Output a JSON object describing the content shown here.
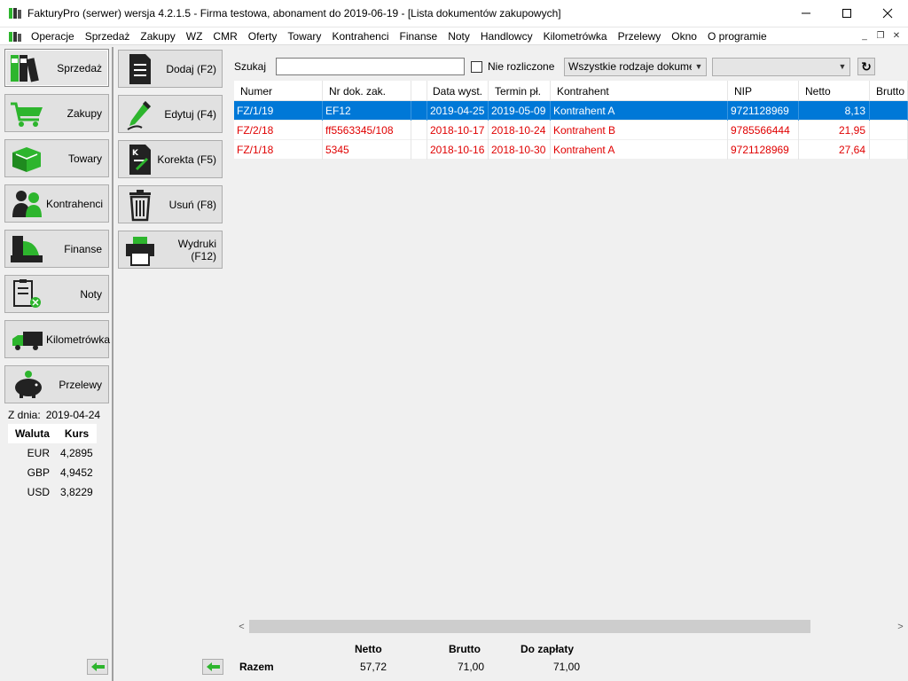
{
  "window": {
    "title": "FakturyPro (serwer) wersja 4.2.1.5 - Firma testowa, abonament do 2019-06-19 - [Lista dokumentów zakupowych]",
    "minimize": "—",
    "maximize": "☐",
    "close": "✕"
  },
  "menu": {
    "items": [
      "Operacje",
      "Sprzedaż",
      "Zakupy",
      "WZ",
      "CMR",
      "Oferty",
      "Towary",
      "Kontrahenci",
      "Finanse",
      "Noty",
      "Handlowcy",
      "Kilometrówka",
      "Przelewy",
      "Okno",
      "O programie"
    ],
    "mdi_min": "_",
    "mdi_restore": "❐",
    "mdi_close": "✕"
  },
  "sidebar": {
    "items": [
      {
        "label": "Sprzedaż",
        "icon": "binders-icon"
      },
      {
        "label": "Zakupy",
        "icon": "cart-icon"
      },
      {
        "label": "Towary",
        "icon": "box-icon"
      },
      {
        "label": "Kontrahenci",
        "icon": "people-icon"
      },
      {
        "label": "Finanse",
        "icon": "cash-register-icon"
      },
      {
        "label": "Noty",
        "icon": "clipboard-icon"
      },
      {
        "label": "Kilometrówka",
        "icon": "truck-icon"
      },
      {
        "label": "Przelewy",
        "icon": "piggy-bank-icon"
      }
    ],
    "rates": {
      "date_label": "Z dnia:",
      "date": "2019-04-24",
      "col_currency": "Waluta",
      "col_rate": "Kurs",
      "rows": [
        {
          "currency": "EUR",
          "rate": "4,2895"
        },
        {
          "currency": "GBP",
          "rate": "4,9452"
        },
        {
          "currency": "USD",
          "rate": "3,8229"
        }
      ]
    }
  },
  "actions": {
    "items": [
      {
        "label": "Dodaj (F2)",
        "icon": "document-icon"
      },
      {
        "label": "Edytuj (F4)",
        "icon": "pen-icon"
      },
      {
        "label": "Korekta (F5)",
        "icon": "correction-document-icon"
      },
      {
        "label": "Usuń (F8)",
        "icon": "trash-icon"
      },
      {
        "label": "Wydruki (F12)",
        "icon": "printer-icon"
      }
    ]
  },
  "toolbar": {
    "search_label": "Szukaj",
    "search_value": "",
    "unsettled_label": "Nie rozliczone",
    "doc_type_value": "Wszystkie rodzaje dokumentów",
    "filter2_value": "",
    "refresh_icon": "↻"
  },
  "grid": {
    "columns": [
      "Numer",
      "Nr dok. zak.",
      "",
      "Data wyst.",
      "Termin pł.",
      "Kontrahent",
      "NIP",
      "Netto",
      "Brutto"
    ],
    "rows": [
      {
        "numer": "FZ/1/19",
        "nr_dok": "EF12",
        "extra": "",
        "data": "2019-04-25",
        "termin": "2019-05-09",
        "kontrahent": "Kontrahent A",
        "nip": "9721128969",
        "netto": "8,13",
        "brutto": "",
        "state": "selected"
      },
      {
        "numer": "FZ/2/18",
        "nr_dok": "ff5563345/108",
        "extra": "",
        "data": "2018-10-17",
        "termin": "2018-10-24",
        "kontrahent": "Kontrahent B",
        "nip": "9785566444",
        "netto": "21,95",
        "brutto": "",
        "state": "overdue"
      },
      {
        "numer": "FZ/1/18",
        "nr_dok": "5345",
        "extra": "",
        "data": "2018-10-16",
        "termin": "2018-10-30",
        "kontrahent": "Kontrahent A",
        "nip": "9721128969",
        "netto": "27,64",
        "brutto": "",
        "state": "overdue"
      }
    ]
  },
  "scroll": {
    "left": "<",
    "right": ">"
  },
  "totals": {
    "label": "Razem",
    "netto_label": "Netto",
    "brutto_label": "Brutto",
    "do_zaplaty_label": "Do zapłaty",
    "netto": "57,72",
    "brutto": "71,00",
    "do_zaplaty": "71,00"
  },
  "colors": {
    "accent_green": "#2db52d",
    "selection_blue": "#0078d7",
    "overdue_red": "#e00000"
  }
}
